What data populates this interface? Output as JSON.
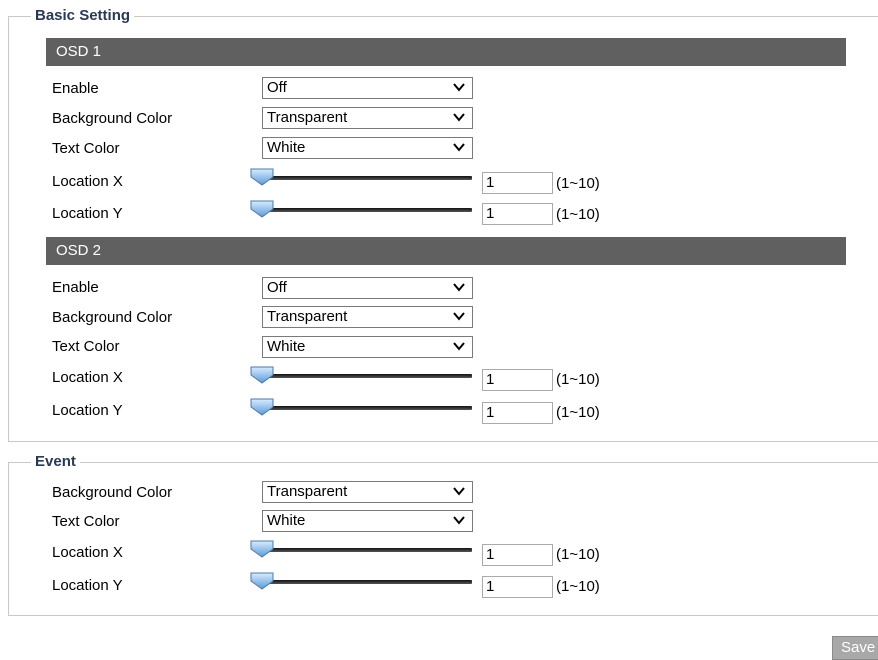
{
  "basic": {
    "legend": "Basic Setting",
    "osd1": {
      "header": "OSD 1",
      "enable": {
        "label": "Enable",
        "value": "Off"
      },
      "background": {
        "label": "Background Color",
        "value": "Transparent"
      },
      "text_color": {
        "label": "Text Color",
        "value": "White"
      },
      "loc_x": {
        "label": "Location X",
        "value": "1",
        "range": "(1~10)"
      },
      "loc_y": {
        "label": "Location Y",
        "value": "1",
        "range": "(1~10)"
      }
    },
    "osd2": {
      "header": "OSD 2",
      "enable": {
        "label": "Enable",
        "value": "Off"
      },
      "background": {
        "label": "Background Color",
        "value": "Transparent"
      },
      "text_color": {
        "label": "Text Color",
        "value": "White"
      },
      "loc_x": {
        "label": "Location X",
        "value": "1",
        "range": "(1~10)"
      },
      "loc_y": {
        "label": "Location Y",
        "value": "1",
        "range": "(1~10)"
      }
    }
  },
  "event": {
    "legend": "Event",
    "background": {
      "label": "Background Color",
      "value": "Transparent"
    },
    "text_color": {
      "label": "Text Color",
      "value": "White"
    },
    "loc_x": {
      "label": "Location X",
      "value": "1",
      "range": "(1~10)"
    },
    "loc_y": {
      "label": "Location Y",
      "value": "1",
      "range": "(1~10)"
    }
  },
  "save_label": "Save",
  "colors": {
    "header_bg": "#606060",
    "legend_text": "#2b3a54",
    "slider_thumb": "#7fb0e0"
  },
  "icons": {
    "dropdown": "chevron-down-icon",
    "slider_thumb": "slider-thumb-icon"
  }
}
